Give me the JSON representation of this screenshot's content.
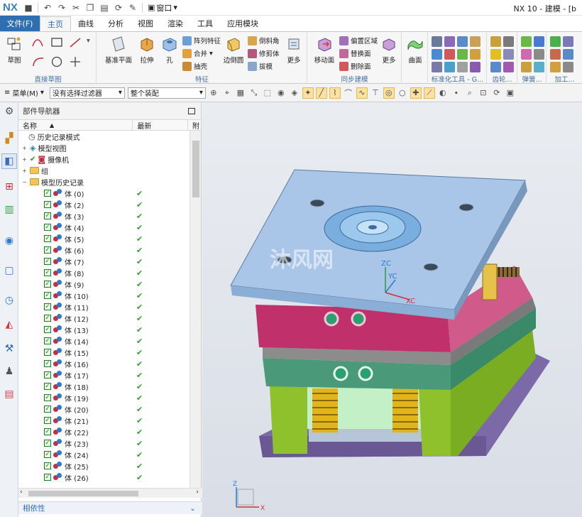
{
  "app": {
    "logo": "NX",
    "title": "NX 10 - 建模 - [b",
    "window_menu": "窗口"
  },
  "tabs": [
    "主页",
    "曲线",
    "分析",
    "视图",
    "渲染",
    "工具",
    "应用模块"
  ],
  "file_menu": "文件(F)",
  "active_tab": "主页",
  "ribbon": {
    "sketch_group": {
      "label": "直接草图",
      "sketch": "草图"
    },
    "feature_group": {
      "label": "特征",
      "datum_plane": "基准平面",
      "extrude": "拉伸",
      "hole": "孔",
      "pattern_feature": "阵列特征",
      "unite": "合并",
      "shell": "抽壳",
      "edge_blend": "边倒圆",
      "chamfer": "倒斜角",
      "trim_body": "修剪体",
      "draft": "拔模",
      "more": "更多"
    },
    "sync_group": {
      "label": "同步建模",
      "move_face": "移动面",
      "offset_region": "偏置区域",
      "replace_face": "替换面",
      "delete_face": "删除面",
      "more": "更多"
    },
    "surface_group": {
      "surface": "曲面"
    },
    "standard_group": {
      "label": "标准化工具 - G..."
    },
    "gear_group": {
      "label": "齿轮..."
    },
    "spring_group": {
      "label": "弹簧..."
    },
    "machining_group": {
      "label": "加工..."
    }
  },
  "selection_bar": {
    "menu": "菜单(M)",
    "filter": "没有选择过滤器",
    "scope": "整个装配"
  },
  "navigator": {
    "title": "部件导航器",
    "col_name": "名称",
    "col_latest": "最新",
    "col_extra": "附",
    "nodes": {
      "history_mode": "历史记录模式",
      "model_views": "模型视图",
      "cameras": "摄像机",
      "groups": "组",
      "model_history": "模型历史记录"
    },
    "bodies": [
      "体 (0)",
      "体 (2)",
      "体 (3)",
      "体 (4)",
      "体 (5)",
      "体 (6)",
      "体 (7)",
      "体 (8)",
      "体 (9)",
      "体 (10)",
      "体 (11)",
      "体 (12)",
      "体 (13)",
      "体 (14)",
      "体 (15)",
      "体 (16)",
      "体 (17)",
      "体 (18)",
      "体 (19)",
      "体 (20)",
      "体 (21)",
      "体 (22)",
      "体 (23)",
      "体 (24)",
      "体 (25)",
      "体 (26)"
    ],
    "dependencies": "相依性"
  },
  "viewport": {
    "axis_z": "ZC",
    "axis_y": "YC",
    "axis_x": "XC",
    "triad_z": "Z",
    "triad_x": "X",
    "watermark": "沐风网",
    "colors": {
      "top_plate": "#a9c6e8",
      "a_plate": "#c0306a",
      "b_plate": "#4a9a7a",
      "support_plate": "#8c8c8c",
      "spacer_block": "#8ec12b",
      "clamp_plate": "#7c6aa8",
      "ejector_plate": "#c4f0c8",
      "spring": "#e0b41a"
    }
  }
}
